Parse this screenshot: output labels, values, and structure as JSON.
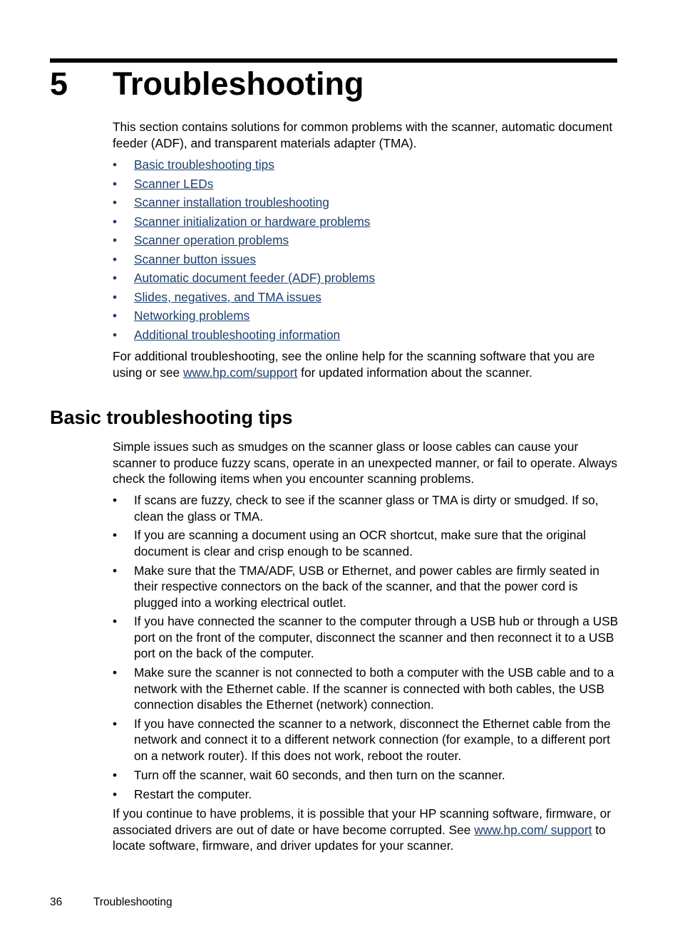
{
  "chapter": {
    "number": "5",
    "title": "Troubleshooting",
    "intro": "This section contains solutions for common problems with the scanner, automatic document feeder (ADF), and transparent materials adapter (TMA).",
    "bullet_glyph": "•",
    "links": [
      "Basic troubleshooting tips",
      "Scanner LEDs",
      "Scanner installation troubleshooting",
      "Scanner initialization or hardware problems",
      "Scanner operation problems",
      "Scanner button issues",
      "Automatic document feeder (ADF) problems",
      "Slides, negatives, and TMA issues",
      "Networking problems",
      "Additional troubleshooting information"
    ],
    "additional": {
      "before": "For additional troubleshooting, see the online help for the scanning software that you are using or see ",
      "link": "www.hp.com/support",
      "after": " for updated information about the scanner."
    }
  },
  "section": {
    "title": "Basic troubleshooting tips",
    "intro": "Simple issues such as smudges on the scanner glass or loose cables can cause your scanner to produce fuzzy scans, operate in an unexpected manner, or fail to operate. Always check the following items when you encounter scanning problems.",
    "tips": [
      "If scans are fuzzy, check to see if the scanner glass or TMA is dirty or smudged. If so, clean the glass or TMA.",
      "If you are scanning a document using an OCR shortcut, make sure that the original document is clear and crisp enough to be scanned.",
      "Make sure that the TMA/ADF, USB or Ethernet, and power cables are firmly seated in their respective connectors on the back of the scanner, and that the power cord is plugged into a working electrical outlet.",
      "If you have connected the scanner to the computer through a USB hub or through a USB port on the front of the computer, disconnect the scanner and then reconnect it to a USB port on the back of the computer.",
      "Make sure the scanner is not connected to both a computer with the USB cable and to a network with the Ethernet cable. If the scanner is connected with both cables, the USB connection disables the Ethernet (network) connection.",
      "If you have connected the scanner to a network, disconnect the Ethernet cable from the network and connect it to a different network connection (for example, to a different port on a network router). If this does not work, reboot the router.",
      "Turn off the scanner, wait 60 seconds, and then turn on the scanner.",
      "Restart the computer."
    ],
    "closing": {
      "before": "If you continue to have problems, it is possible that your HP scanning software, firmware, or associated drivers are out of date or have become corrupted. See ",
      "link": "www.hp.com/ support",
      "after": " to locate software, firmware, and driver updates for your scanner."
    }
  },
  "footer": {
    "page_number": "36",
    "chapter_name": "Troubleshooting"
  },
  "colors": {
    "link": "#1b3f6f",
    "text": "#000000"
  }
}
